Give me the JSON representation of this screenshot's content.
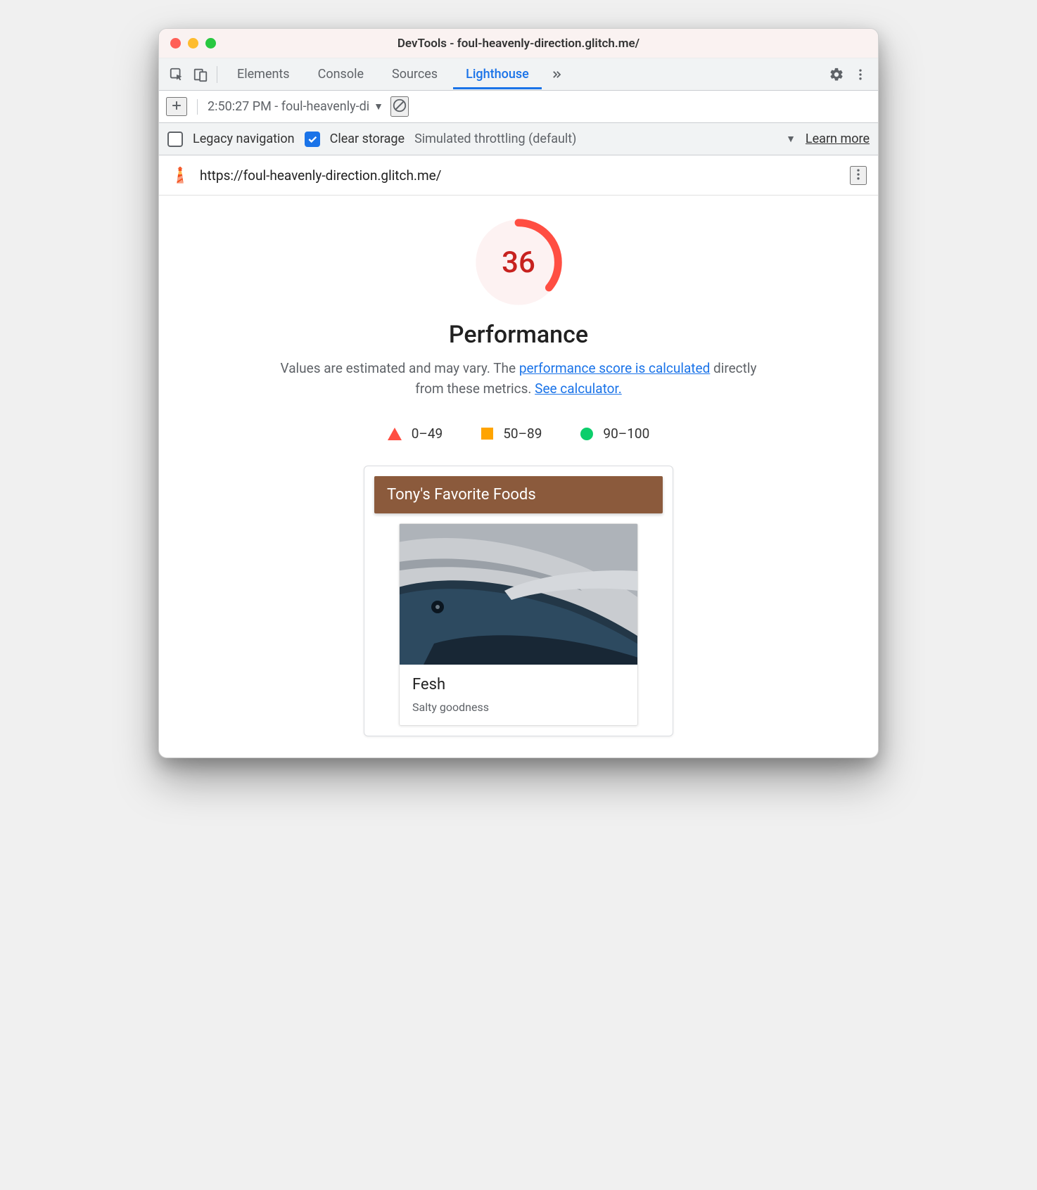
{
  "window": {
    "title": "DevTools - foul-heavenly-direction.glitch.me/"
  },
  "tabs": {
    "items": [
      "Elements",
      "Console",
      "Sources",
      "Lighthouse"
    ],
    "activeIndex": 3
  },
  "subbar": {
    "report_label": "2:50:27 PM - foul-heavenly-di"
  },
  "options": {
    "legacy_label": "Legacy navigation",
    "legacy_checked": false,
    "clear_label": "Clear storage",
    "clear_checked": true,
    "throttling_label": "Simulated throttling (default)",
    "learn_more": "Learn more"
  },
  "report": {
    "url": "https://foul-heavenly-direction.glitch.me/",
    "score": 36,
    "category": "Performance",
    "description_prefix": "Values are estimated and may vary. The ",
    "description_link1": "performance score is calculated",
    "description_mid": " directly from these metrics. ",
    "description_link2": "See calculator.",
    "legend": {
      "fail": "0–49",
      "avg": "50–89",
      "pass": "90–100"
    }
  },
  "screenshot": {
    "banner": "Tony's Favorite Foods",
    "item_name": "Fesh",
    "item_sub": "Salty goodness"
  }
}
